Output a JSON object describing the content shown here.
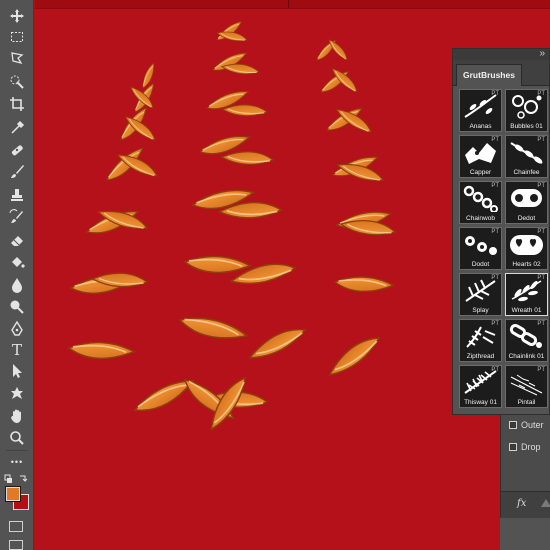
{
  "panel": {
    "title": "GrutBrushes",
    "collapse_icon": "double-chevron-right",
    "badge": "PT",
    "brushes": [
      {
        "label": "Ananas",
        "icon": "ananas-brush"
      },
      {
        "label": "Bubbles 01",
        "icon": "bubbles-brush"
      },
      {
        "label": "Capper",
        "icon": "capper-brush"
      },
      {
        "label": "Chainfee",
        "icon": "chainfee-brush"
      },
      {
        "label": "Chainwob",
        "icon": "chainwob-brush"
      },
      {
        "label": "Dedot",
        "icon": "dedot-brush"
      },
      {
        "label": "Dodot",
        "icon": "dodot-brush"
      },
      {
        "label": "Hearts 02",
        "icon": "hearts-brush"
      },
      {
        "label": "Splay",
        "icon": "splay-brush"
      },
      {
        "label": "Wreath 01",
        "icon": "wreath-brush"
      },
      {
        "label": "Zipthread",
        "icon": "zipthread-brush"
      },
      {
        "label": "Chainlink 01",
        "icon": "chainlink-brush"
      },
      {
        "label": "Thisway 01",
        "icon": "thisway-brush"
      },
      {
        "label": "Pintail",
        "icon": "pintail-brush"
      }
    ],
    "selected": "Wreath 01"
  },
  "layer_effects": {
    "items": [
      {
        "label": "Outer",
        "checked": false
      },
      {
        "label": "Drop",
        "checked": false
      }
    ],
    "footer_fx": "fx"
  },
  "colors": {
    "foreground": "#e07a25",
    "background": "#b50f14",
    "canvas": "#b5111a",
    "wreath": "#e8892c"
  },
  "toolbar": {
    "tools": [
      "move-tool",
      "marquee-tool",
      "lasso-tool",
      "quick-selection-tool",
      "crop-tool",
      "eyedropper-tool",
      "healing-brush-tool",
      "brush-tool",
      "clone-stamp-tool",
      "history-brush-tool",
      "eraser-tool",
      "paint-bucket-tool",
      "blur-tool",
      "dodge-tool",
      "pen-tool",
      "type-tool",
      "path-selection-tool",
      "custom-shape-tool",
      "hand-tool",
      "zoom-tool",
      "more-tools"
    ],
    "type_tool_glyph": "T",
    "more_glyph": "•••"
  }
}
